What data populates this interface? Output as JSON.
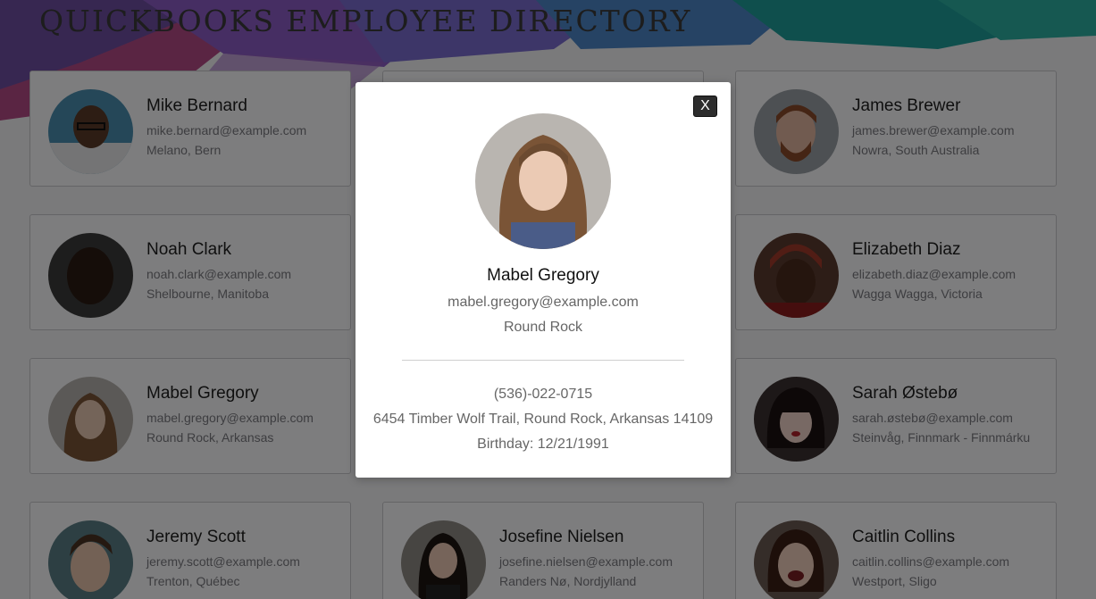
{
  "page": {
    "title": "QUICKBOOKS EMPLOYEE DIRECTORY"
  },
  "employees": [
    {
      "name": "Mike Bernard",
      "email": "mike.bernard@example.com",
      "location": "Melano, Bern",
      "avatar": "male-dark-skin-glasses"
    },
    {
      "name": "",
      "email": "",
      "location": "",
      "avatar": "hidden"
    },
    {
      "name": "James Brewer",
      "email": "james.brewer@example.com",
      "location": "Nowra, South Australia",
      "avatar": "male-red-hair-beard"
    },
    {
      "name": "Noah Clark",
      "email": "noah.clark@example.com",
      "location": "Shelbourne, Manitoba",
      "avatar": "male-dark-skin"
    },
    {
      "name": "",
      "email": "",
      "location": "",
      "avatar": "hidden"
    },
    {
      "name": "Elizabeth Diaz",
      "email": "elizabeth.diaz@example.com",
      "location": "Wagga Wagga, Victoria",
      "avatar": "female-headwrap"
    },
    {
      "name": "Mabel Gregory",
      "email": "mabel.gregory@example.com",
      "location": "Round Rock, Arkansas",
      "avatar": "female-wavy-hair"
    },
    {
      "name": "",
      "email": "",
      "location": "",
      "avatar": "hidden"
    },
    {
      "name": "Sarah Østebø",
      "email": "sarah.østebø@example.com",
      "location": "Steinvåg, Finnmark - Finnmárku",
      "avatar": "female-dark-bangs"
    },
    {
      "name": "Jeremy Scott",
      "email": "jeremy.scott@example.com",
      "location": "Trenton, Québec",
      "avatar": "male-short-hair"
    },
    {
      "name": "Josefine Nielsen",
      "email": "josefine.nielsen@example.com",
      "location": "Randers Nø, Nordjylland",
      "avatar": "female-dark-hair"
    },
    {
      "name": "Caitlin Collins",
      "email": "caitlin.collins@example.com",
      "location": "Westport, Sligo",
      "avatar": "female-smiling"
    }
  ],
  "modal": {
    "close_label": "X",
    "name": "Mabel Gregory",
    "email": "mabel.gregory@example.com",
    "city": "Round Rock",
    "phone": "(536)-022-0715",
    "address": "6454 Timber Wolf Trail, Round Rock, Arkansas 14109",
    "birthday": "Birthday: 12/21/1991",
    "avatar": "female-wavy-hair"
  },
  "colors": {
    "overlay": "rgba(0,0,0,0.5)",
    "close_button": "#2d2d2d"
  }
}
